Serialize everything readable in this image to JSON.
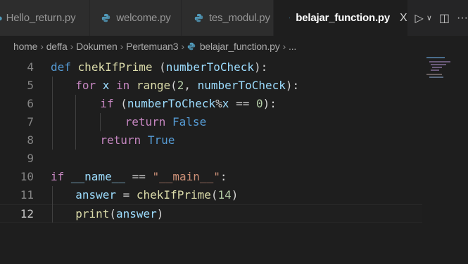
{
  "tabs": [
    {
      "label": "Hello_return.py",
      "active": false
    },
    {
      "label": "welcome.py",
      "active": false
    },
    {
      "label": "tes_modul.py",
      "active": false
    },
    {
      "label": "belajar_function.py",
      "active": true,
      "close": "X"
    }
  ],
  "tab_actions": {
    "run": "▷",
    "run_dropdown": "∨",
    "split": "◫",
    "more": "···"
  },
  "breadcrumb": {
    "items": [
      "home",
      "deffa",
      "Dokumen",
      "Pertemuan3",
      "belajar_function.py",
      "..."
    ],
    "separator": "›"
  },
  "editor": {
    "current_line": 12,
    "line_numbers": [
      "4",
      "5",
      "6",
      "7",
      "8",
      "9",
      "10",
      "11",
      "12"
    ],
    "lines": [
      {
        "tokens": [
          [
            "kw",
            "def"
          ],
          [
            "plain",
            " "
          ],
          [
            "fn",
            "chekIfPrime"
          ],
          [
            "plain",
            " ("
          ],
          [
            "var",
            "numberToCheck"
          ],
          [
            "plain",
            "):"
          ]
        ]
      },
      {
        "tokens": [
          [
            "ctl",
            "for"
          ],
          [
            "plain",
            " "
          ],
          [
            "var",
            "x"
          ],
          [
            "plain",
            " "
          ],
          [
            "ctl",
            "in"
          ],
          [
            "plain",
            " "
          ],
          [
            "fn",
            "range"
          ],
          [
            "plain",
            "("
          ],
          [
            "num",
            "2"
          ],
          [
            "plain",
            ", "
          ],
          [
            "var",
            "numberToCheck"
          ],
          [
            "plain",
            "):"
          ]
        ]
      },
      {
        "tokens": [
          [
            "ctl",
            "if"
          ],
          [
            "plain",
            " ("
          ],
          [
            "var",
            "numberToCheck"
          ],
          [
            "plain",
            "%"
          ],
          [
            "var",
            "x"
          ],
          [
            "plain",
            " == "
          ],
          [
            "num",
            "0"
          ],
          [
            "plain",
            "):"
          ]
        ]
      },
      {
        "tokens": [
          [
            "ctl",
            "return"
          ],
          [
            "plain",
            " "
          ],
          [
            "bool",
            "False"
          ]
        ]
      },
      {
        "tokens": [
          [
            "ctl",
            "return"
          ],
          [
            "plain",
            " "
          ],
          [
            "bool",
            "True"
          ]
        ]
      },
      {
        "tokens": []
      },
      {
        "tokens": [
          [
            "ctl",
            "if"
          ],
          [
            "plain",
            " "
          ],
          [
            "var",
            "__name__"
          ],
          [
            "plain",
            " == "
          ],
          [
            "str",
            "\"__main__\""
          ],
          [
            "plain",
            ":"
          ]
        ]
      },
      {
        "tokens": [
          [
            "var",
            "answer"
          ],
          [
            "plain",
            " = "
          ],
          [
            "fn",
            "chekIfPrime"
          ],
          [
            "plain",
            "("
          ],
          [
            "num",
            "14"
          ],
          [
            "plain",
            ")"
          ]
        ]
      },
      {
        "tokens": [
          [
            "fn",
            "print"
          ],
          [
            "plain",
            "("
          ],
          [
            "var",
            "answer"
          ],
          [
            "plain",
            ")"
          ]
        ]
      }
    ]
  },
  "colors": {
    "background": "#1e1e1e",
    "tabbar": "#252526",
    "inactive_tab": "#2d2d2d",
    "keyword": "#569cd6",
    "control": "#c586c0",
    "function": "#dcdcaa",
    "variable": "#9cdcfe",
    "number": "#b5cea8",
    "string": "#ce9178",
    "python_icon": "#519aba"
  },
  "icons": {
    "file_icon": "python-file-icon"
  }
}
